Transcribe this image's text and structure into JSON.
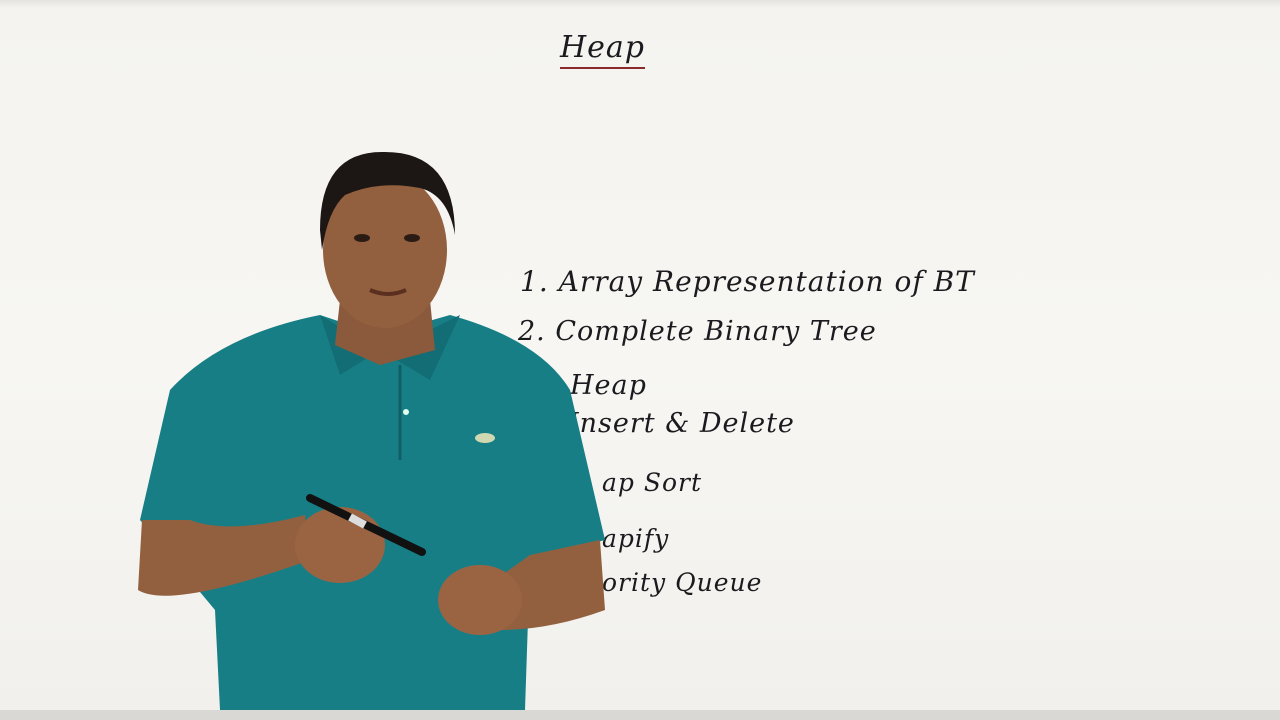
{
  "board": {
    "title": "Heap",
    "lines": [
      "1. Array Representation of BT",
      "2. Complete Binary Tree",
      "Heap",
      "Insert & Delete",
      "ap Sort",
      "apify",
      "ority Queue"
    ]
  },
  "colors": {
    "shirt": "#177e86",
    "board": "#f5f4f0",
    "ink": "#1b1b1f"
  }
}
